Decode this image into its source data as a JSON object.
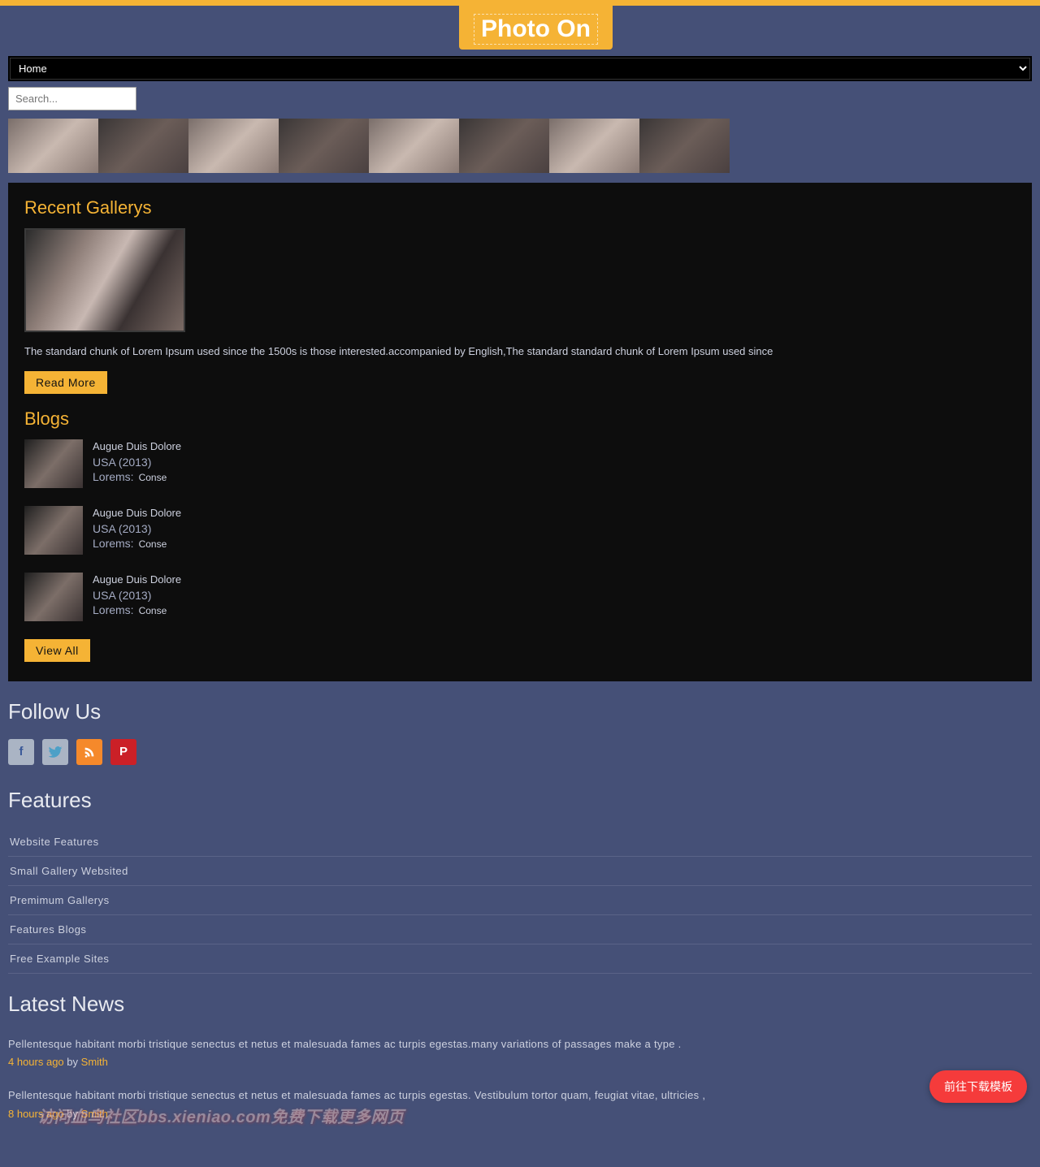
{
  "logo": "Photo On",
  "nav": {
    "selected": "Home"
  },
  "search": {
    "placeholder": "Search..."
  },
  "recentGallerys": {
    "heading": "Recent Gallerys",
    "desc": "The standard chunk of Lorem Ipsum used since the 1500s is those interested.accompanied by English,The standard standard chunk of Lorem Ipsum used since",
    "readMore": "Read More"
  },
  "blogs": {
    "heading": "Blogs",
    "viewAll": "View All",
    "items": [
      {
        "title": "Augue Duis Dolore",
        "subtitle": "USA (2013)",
        "loremsLabel": "Lorems:",
        "loremsVal": "Conse"
      },
      {
        "title": "Augue Duis Dolore",
        "subtitle": "USA (2013)",
        "loremsLabel": "Lorems:",
        "loremsVal": "Conse"
      },
      {
        "title": "Augue Duis Dolore",
        "subtitle": "USA (2013)",
        "loremsLabel": "Lorems:",
        "loremsVal": "Conse"
      }
    ]
  },
  "followUs": {
    "heading": "Follow Us"
  },
  "features": {
    "heading": "Features",
    "items": [
      "Website Features",
      "Small Gallery Websited",
      "Premimum Gallerys",
      "Features Blogs",
      "Free Example Sites"
    ]
  },
  "latestNews": {
    "heading": "Latest News",
    "items": [
      {
        "text": "Pellentesque habitant morbi tristique senectus et netus et malesuada fames ac turpis egestas.many variations of passages make a type .",
        "time": "4 hours ago",
        "by": "by",
        "author": "Smith"
      },
      {
        "text": "Pellentesque habitant morbi tristique senectus et netus et malesuada fames ac turpis egestas. Vestibulum tortor quam, feugiat vitae, ultricies ,",
        "time": "8 hours ago",
        "by": "by",
        "author": "Smith"
      }
    ]
  },
  "cta": "前往下载模板",
  "watermark": "访问血鸟社区bbs.xieniao.com免费下载更多网页"
}
